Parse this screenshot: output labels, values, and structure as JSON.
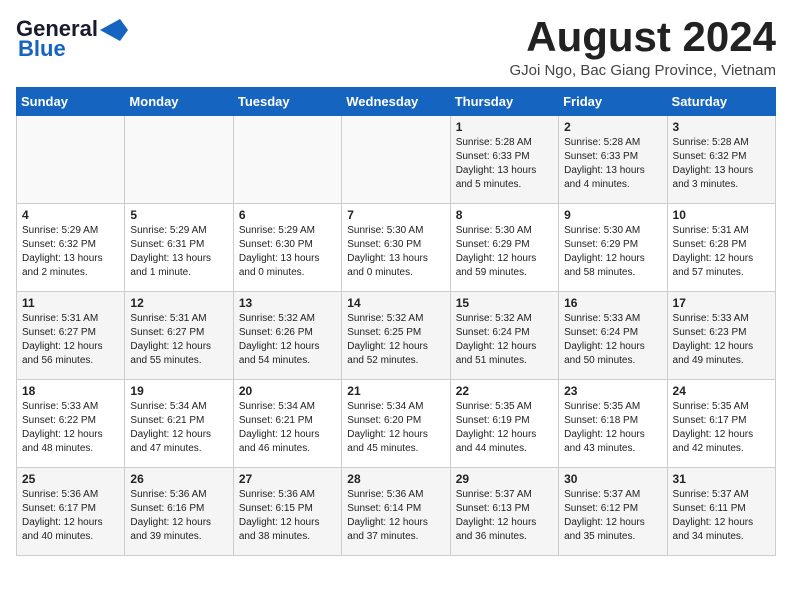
{
  "logo": {
    "line1": "General",
    "line2": "Blue"
  },
  "title": "August 2024",
  "subtitle": "GJoi Ngo, Bac Giang Province, Vietnam",
  "days_header": [
    "Sunday",
    "Monday",
    "Tuesday",
    "Wednesday",
    "Thursday",
    "Friday",
    "Saturday"
  ],
  "weeks": [
    [
      {
        "day": "",
        "info": ""
      },
      {
        "day": "",
        "info": ""
      },
      {
        "day": "",
        "info": ""
      },
      {
        "day": "",
        "info": ""
      },
      {
        "day": "1",
        "info": "Sunrise: 5:28 AM\nSunset: 6:33 PM\nDaylight: 13 hours\nand 5 minutes."
      },
      {
        "day": "2",
        "info": "Sunrise: 5:28 AM\nSunset: 6:33 PM\nDaylight: 13 hours\nand 4 minutes."
      },
      {
        "day": "3",
        "info": "Sunrise: 5:28 AM\nSunset: 6:32 PM\nDaylight: 13 hours\nand 3 minutes."
      }
    ],
    [
      {
        "day": "4",
        "info": "Sunrise: 5:29 AM\nSunset: 6:32 PM\nDaylight: 13 hours\nand 2 minutes."
      },
      {
        "day": "5",
        "info": "Sunrise: 5:29 AM\nSunset: 6:31 PM\nDaylight: 13 hours\nand 1 minute."
      },
      {
        "day": "6",
        "info": "Sunrise: 5:29 AM\nSunset: 6:30 PM\nDaylight: 13 hours\nand 0 minutes."
      },
      {
        "day": "7",
        "info": "Sunrise: 5:30 AM\nSunset: 6:30 PM\nDaylight: 13 hours\nand 0 minutes."
      },
      {
        "day": "8",
        "info": "Sunrise: 5:30 AM\nSunset: 6:29 PM\nDaylight: 12 hours\nand 59 minutes."
      },
      {
        "day": "9",
        "info": "Sunrise: 5:30 AM\nSunset: 6:29 PM\nDaylight: 12 hours\nand 58 minutes."
      },
      {
        "day": "10",
        "info": "Sunrise: 5:31 AM\nSunset: 6:28 PM\nDaylight: 12 hours\nand 57 minutes."
      }
    ],
    [
      {
        "day": "11",
        "info": "Sunrise: 5:31 AM\nSunset: 6:27 PM\nDaylight: 12 hours\nand 56 minutes."
      },
      {
        "day": "12",
        "info": "Sunrise: 5:31 AM\nSunset: 6:27 PM\nDaylight: 12 hours\nand 55 minutes."
      },
      {
        "day": "13",
        "info": "Sunrise: 5:32 AM\nSunset: 6:26 PM\nDaylight: 12 hours\nand 54 minutes."
      },
      {
        "day": "14",
        "info": "Sunrise: 5:32 AM\nSunset: 6:25 PM\nDaylight: 12 hours\nand 52 minutes."
      },
      {
        "day": "15",
        "info": "Sunrise: 5:32 AM\nSunset: 6:24 PM\nDaylight: 12 hours\nand 51 minutes."
      },
      {
        "day": "16",
        "info": "Sunrise: 5:33 AM\nSunset: 6:24 PM\nDaylight: 12 hours\nand 50 minutes."
      },
      {
        "day": "17",
        "info": "Sunrise: 5:33 AM\nSunset: 6:23 PM\nDaylight: 12 hours\nand 49 minutes."
      }
    ],
    [
      {
        "day": "18",
        "info": "Sunrise: 5:33 AM\nSunset: 6:22 PM\nDaylight: 12 hours\nand 48 minutes."
      },
      {
        "day": "19",
        "info": "Sunrise: 5:34 AM\nSunset: 6:21 PM\nDaylight: 12 hours\nand 47 minutes."
      },
      {
        "day": "20",
        "info": "Sunrise: 5:34 AM\nSunset: 6:21 PM\nDaylight: 12 hours\nand 46 minutes."
      },
      {
        "day": "21",
        "info": "Sunrise: 5:34 AM\nSunset: 6:20 PM\nDaylight: 12 hours\nand 45 minutes."
      },
      {
        "day": "22",
        "info": "Sunrise: 5:35 AM\nSunset: 6:19 PM\nDaylight: 12 hours\nand 44 minutes."
      },
      {
        "day": "23",
        "info": "Sunrise: 5:35 AM\nSunset: 6:18 PM\nDaylight: 12 hours\nand 43 minutes."
      },
      {
        "day": "24",
        "info": "Sunrise: 5:35 AM\nSunset: 6:17 PM\nDaylight: 12 hours\nand 42 minutes."
      }
    ],
    [
      {
        "day": "25",
        "info": "Sunrise: 5:36 AM\nSunset: 6:17 PM\nDaylight: 12 hours\nand 40 minutes."
      },
      {
        "day": "26",
        "info": "Sunrise: 5:36 AM\nSunset: 6:16 PM\nDaylight: 12 hours\nand 39 minutes."
      },
      {
        "day": "27",
        "info": "Sunrise: 5:36 AM\nSunset: 6:15 PM\nDaylight: 12 hours\nand 38 minutes."
      },
      {
        "day": "28",
        "info": "Sunrise: 5:36 AM\nSunset: 6:14 PM\nDaylight: 12 hours\nand 37 minutes."
      },
      {
        "day": "29",
        "info": "Sunrise: 5:37 AM\nSunset: 6:13 PM\nDaylight: 12 hours\nand 36 minutes."
      },
      {
        "day": "30",
        "info": "Sunrise: 5:37 AM\nSunset: 6:12 PM\nDaylight: 12 hours\nand 35 minutes."
      },
      {
        "day": "31",
        "info": "Sunrise: 5:37 AM\nSunset: 6:11 PM\nDaylight: 12 hours\nand 34 minutes."
      }
    ]
  ]
}
